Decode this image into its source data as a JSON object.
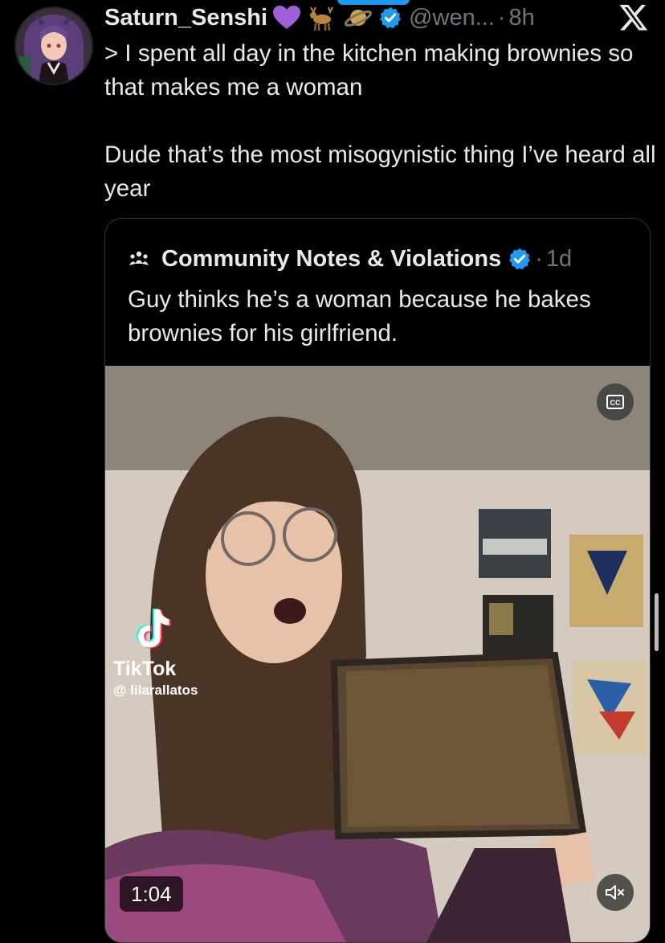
{
  "tweet": {
    "author_name": "Saturn_Senshi",
    "emojis": [
      "purple-heart",
      "deer",
      "saturn"
    ],
    "handle": "@wen...",
    "separator": "·",
    "time": "8h",
    "text_line1": "> I spent all day in the kitchen making brownies so that makes me a woman",
    "text_line2": "Dude that’s the most misogynistic thing I’ve heard all year"
  },
  "quote": {
    "author_name": "Community Notes & Violations",
    "separator": "·",
    "time": "1d",
    "text": "Guy thinks he’s a woman because he bakes brownies for his girlfriend.",
    "video": {
      "duration": "1:04",
      "watermark_brand": "TikTok",
      "watermark_user": "@ lilarallatos",
      "cc_label": "CC"
    }
  },
  "colors": {
    "background": "#000000",
    "text": "#e7e9ea",
    "secondary": "#71767b",
    "verified": "#1d9bf0",
    "border": "#333639"
  }
}
